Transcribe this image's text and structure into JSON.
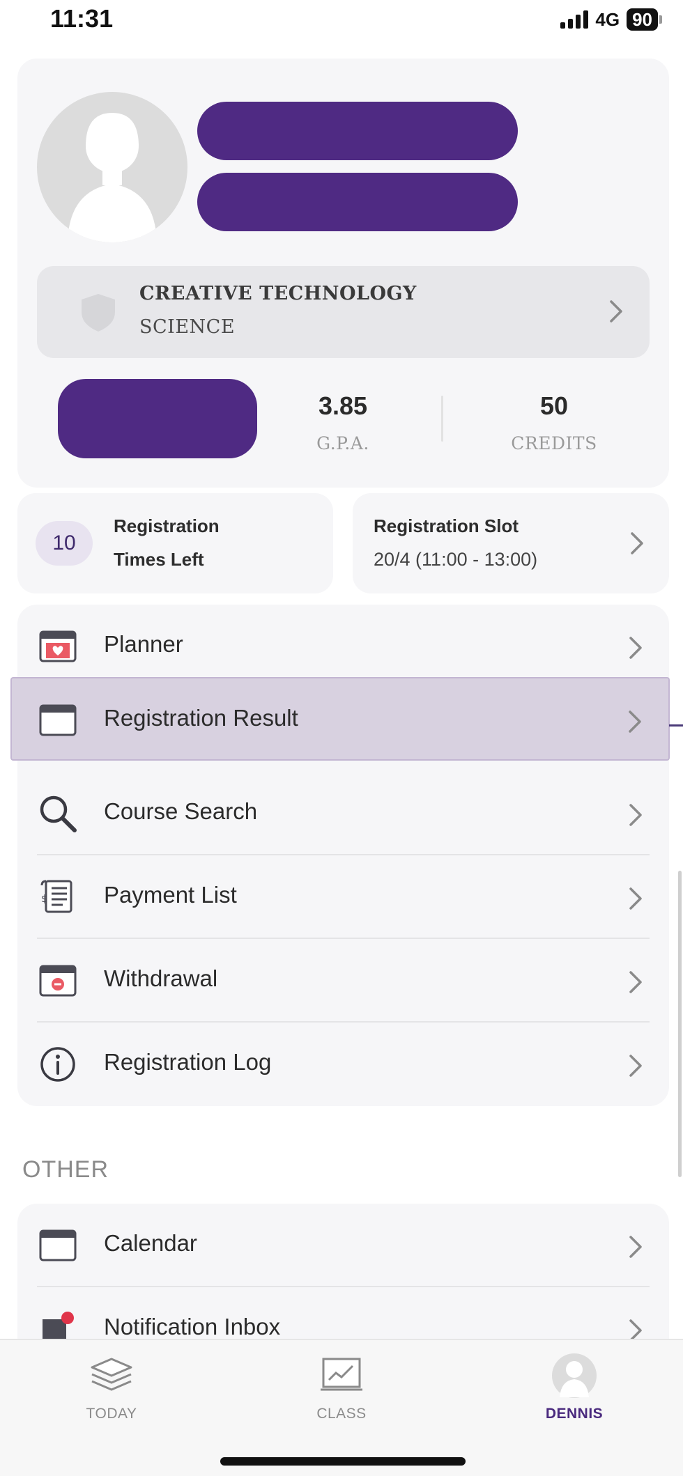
{
  "status_bar": {
    "time": "11:31",
    "network": "4G",
    "battery": "90"
  },
  "profile": {
    "faculty": {
      "title": "CREATIVE TECHNOLOGY",
      "subtitle": "SCIENCE"
    },
    "gpa": {
      "value": "3.85",
      "label": "G.P.A."
    },
    "credits": {
      "value": "50",
      "label": "CREDITS"
    }
  },
  "registration": {
    "times_left": {
      "count": "10",
      "line1": "Registration",
      "line2": "Times Left"
    },
    "slot": {
      "title": "Registration Slot",
      "value": "20/4 (11:00 - 13:00)"
    }
  },
  "menu": [
    {
      "label": "Planner",
      "icon": "planner-icon"
    },
    {
      "label": "Registration Result",
      "icon": "calendar-icon",
      "highlighted": true
    },
    {
      "label": "Course Search",
      "icon": "search-icon"
    },
    {
      "label": "Payment List",
      "icon": "receipt-icon"
    },
    {
      "label": "Withdrawal",
      "icon": "withdrawal-icon"
    },
    {
      "label": "Registration Log",
      "icon": "info-icon"
    }
  ],
  "other": {
    "section_title": "OTHER",
    "items": [
      {
        "label": "Calendar",
        "icon": "calendar-icon"
      },
      {
        "label": "Notification Inbox",
        "icon": "notification-icon"
      }
    ]
  },
  "tabbar": {
    "tabs": [
      {
        "label": "TODAY",
        "icon": "stack-icon"
      },
      {
        "label": "CLASS",
        "icon": "chart-board-icon"
      },
      {
        "label": "DENNIS",
        "icon": "avatar-icon",
        "active": true
      }
    ]
  },
  "colors": {
    "accent": "#4a2a7e",
    "highlight": "#d8d1e0",
    "redaction": "#4f2a83",
    "card": "#f6f6f8",
    "notification_dot": "#e0354a"
  }
}
